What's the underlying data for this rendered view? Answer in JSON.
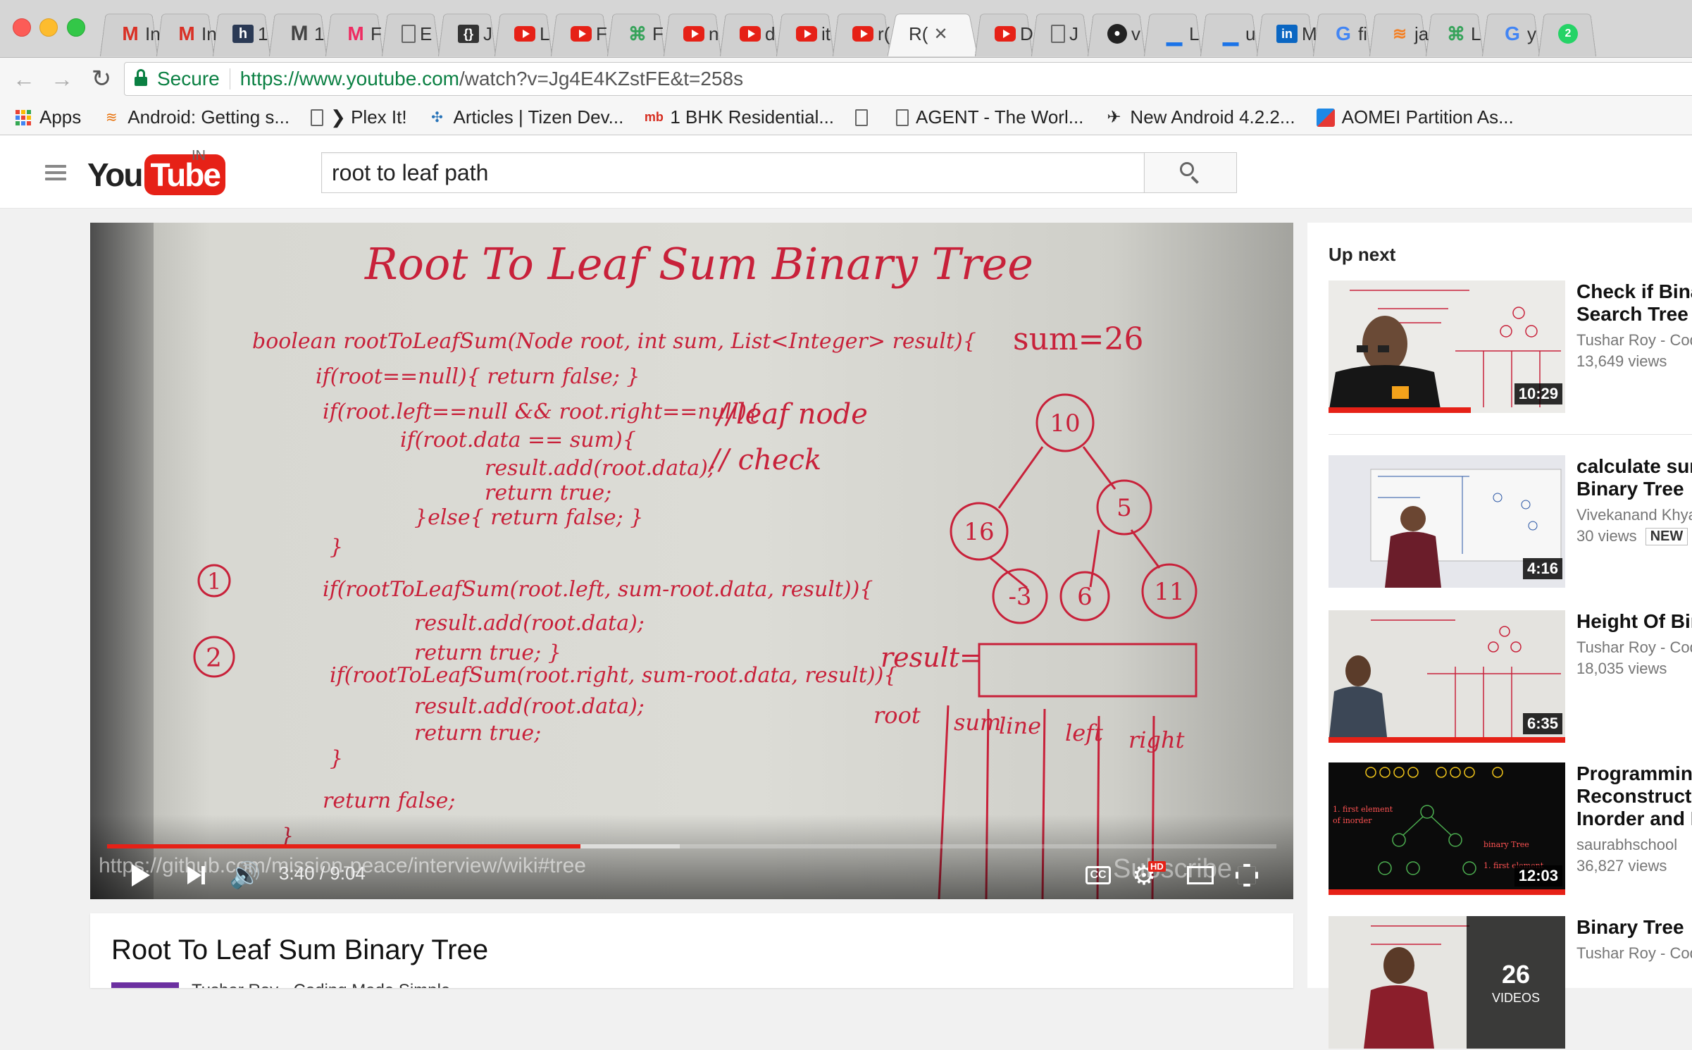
{
  "browser": {
    "tabs": [
      {
        "icon": "gmail-icon",
        "glyph": "M",
        "label": "In"
      },
      {
        "icon": "gmail-icon",
        "glyph": "M",
        "label": "In"
      },
      {
        "icon": "h-icon",
        "glyph": "h",
        "label": "1"
      },
      {
        "icon": "m-icon",
        "glyph": "M",
        "label": "1"
      },
      {
        "icon": "myntra-icon",
        "glyph": "M",
        "label": "F"
      },
      {
        "icon": "document-icon",
        "glyph": "",
        "label": "E"
      },
      {
        "icon": "braces-icon",
        "glyph": "{}",
        "label": "J"
      },
      {
        "icon": "youtube-icon",
        "glyph": "",
        "label": "L"
      },
      {
        "icon": "youtube-icon",
        "glyph": "",
        "label": "F"
      },
      {
        "icon": "leaf-icon",
        "glyph": "⌘",
        "label": "F"
      },
      {
        "icon": "youtube-icon",
        "glyph": "",
        "label": "n"
      },
      {
        "icon": "youtube-icon",
        "glyph": "",
        "label": "d"
      },
      {
        "icon": "youtube-icon",
        "glyph": "",
        "label": "it"
      },
      {
        "icon": "youtube-icon",
        "glyph": "",
        "label": "r("
      },
      {
        "icon": "none",
        "glyph": "",
        "label": "R(",
        "active": true
      },
      {
        "icon": "youtube-icon",
        "glyph": "",
        "label": "D"
      },
      {
        "icon": "document-icon",
        "glyph": "",
        "label": "J"
      },
      {
        "icon": "github-icon",
        "glyph": "●",
        "label": "v"
      },
      {
        "icon": "dash-icon",
        "glyph": "▁",
        "label": "L"
      },
      {
        "icon": "dash-icon",
        "glyph": "▁",
        "label": "u"
      },
      {
        "icon": "linkedin-icon",
        "glyph": "in",
        "label": "M"
      },
      {
        "icon": "google-icon",
        "glyph": "G",
        "label": "fi"
      },
      {
        "icon": "stackoverflow-icon",
        "glyph": "≋",
        "label": "ja"
      },
      {
        "icon": "leaf-icon",
        "glyph": "⌘",
        "label": "L"
      },
      {
        "icon": "google-icon",
        "glyph": "G",
        "label": "y"
      },
      {
        "icon": "whatsapp-icon",
        "glyph": "2",
        "label": ""
      }
    ],
    "active_tab_close": "✕",
    "omnibox": {
      "secure_label": "Secure",
      "url_host": "https://www.youtube.com",
      "url_rest": "/watch?v=Jg4E4KZstFE&t=258s"
    },
    "bookmarks": [
      {
        "icon": "apps-icon",
        "label": "Apps"
      },
      {
        "icon": "android-icon",
        "label": "Android: Getting s..."
      },
      {
        "icon": "document-icon",
        "label": "❯ Plex It!"
      },
      {
        "icon": "tizen-icon",
        "label": "Articles | Tizen Dev..."
      },
      {
        "icon": "magicbricks-icon",
        "label": "1 BHK Residential..."
      },
      {
        "icon": "document-icon",
        "label": ""
      },
      {
        "icon": "document-icon",
        "label": "AGENT - The Worl..."
      },
      {
        "icon": "agent-icon",
        "label": "New Android 4.2.2..."
      },
      {
        "icon": "aomei-icon",
        "label": "AOMEI Partition As..."
      }
    ]
  },
  "youtube": {
    "logo_you": "You",
    "logo_tube": "Tube",
    "country": "IN",
    "search_value": "root to leaf path"
  },
  "player": {
    "time": "3:40 / 9:04",
    "played_fraction": 0.405,
    "loaded_fraction": 0.49,
    "overlay_url": "https://github.com/mission-peace/interview/wiki#tree",
    "overlay_subscribe": "Subscribe",
    "cc_label": "CC",
    "hd_label": "HD",
    "board": {
      "title": "Root  To  Leaf   Sum   Binary   Tree",
      "code_lines": [
        "boolean  rootToLeafSum(Node root, int sum, List<Integer> result){",
        "if(root==null){  return false; }",
        "if(root.left==null && root.right==null){",
        "if(root.data == sum){",
        "result.add(root.data);",
        "return true;",
        "}else{  return false; }",
        "}",
        "if(rootToLeafSum(root.left, sum-root.data, result)){",
        "result.add(root.data);",
        "return true; }",
        "if(rootToLeafSum(root.right, sum-root.data, result)){",
        "result.add(root.data);",
        "return true;",
        "}",
        "return false;",
        "}"
      ],
      "comment_leaf": "//leaf node",
      "comment_check": "// check",
      "marker_1": "1",
      "marker_2": "2",
      "sum_label": "sum=26",
      "tree_nodes": [
        "10",
        "16",
        "5",
        "-3",
        "6",
        "11"
      ],
      "result_label": "result=",
      "table_headers": [
        "root",
        "sum",
        "line",
        "left",
        "right"
      ]
    }
  },
  "video": {
    "title": "Root To Leaf Sum Binary Tree",
    "channel": "Tushar Roy - Coding Made Simple"
  },
  "sidebar": {
    "heading": "Up next",
    "items": [
      {
        "title_1": "Check if Bina",
        "title_2": "Search Tree",
        "channel": "Tushar Roy - Cod",
        "views": "13,649 views",
        "duration": "10:29",
        "watched": 0.6
      },
      {
        "title_1": "calculate sun",
        "title_2": "Binary Tree",
        "channel": "Vivekanand Khya",
        "views": "30 views",
        "badge": "NEW",
        "duration": "4:16",
        "watched": 0
      },
      {
        "title_1": "Height Of Bin",
        "title_2": "",
        "channel": "Tushar Roy - Cod",
        "views": "18,035 views",
        "duration": "6:35",
        "watched": 1.0
      },
      {
        "title_1": "Programming",
        "title_2": "Reconstruct I",
        "title_3": "Inorder and P",
        "channel": "saurabhschool",
        "views": "36,827 views",
        "duration": "12:03",
        "watched": 1.0
      },
      {
        "title_1": "Binary Tree",
        "title_2": "",
        "channel": "Tushar Roy - Cod",
        "playlist_count": "26",
        "playlist_label": "VIDEOS"
      }
    ]
  }
}
